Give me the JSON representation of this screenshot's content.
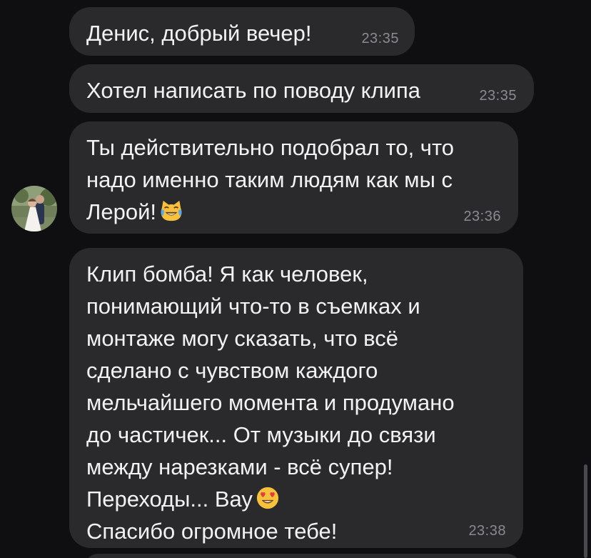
{
  "messages": [
    {
      "text": "Денис, добрый вечер!",
      "time": "23:35"
    },
    {
      "text": "Хотел написать по поводу клипа",
      "time": "23:35"
    },
    {
      "text_lines": [
        "Ты действительно подобрал то, что",
        "надо именно таким людям как мы с",
        "Лерой!"
      ],
      "emoji": "cat-tears-of-joy-emoji",
      "time": "23:36"
    },
    {
      "text_lines": [
        "Клип бомба! Я как человек,",
        "понимающий что-то в съемках и",
        "монтаже могу сказать, что всё",
        "сделано с чувством каждого",
        "мельчайшего момента и продумано",
        "до частичек... От музыки до связи",
        "между нарезками - всё супер!",
        "Переходы... Вау"
      ],
      "emoji": "heart-eyes-emoji",
      "text_last": "Спасибо огромное тебе!",
      "time": "23:38"
    }
  ],
  "colors": {
    "background": "#0f0f11",
    "bubble": "#2a2a2d",
    "text": "#f2f2f4",
    "time": "#8a8a8f"
  }
}
